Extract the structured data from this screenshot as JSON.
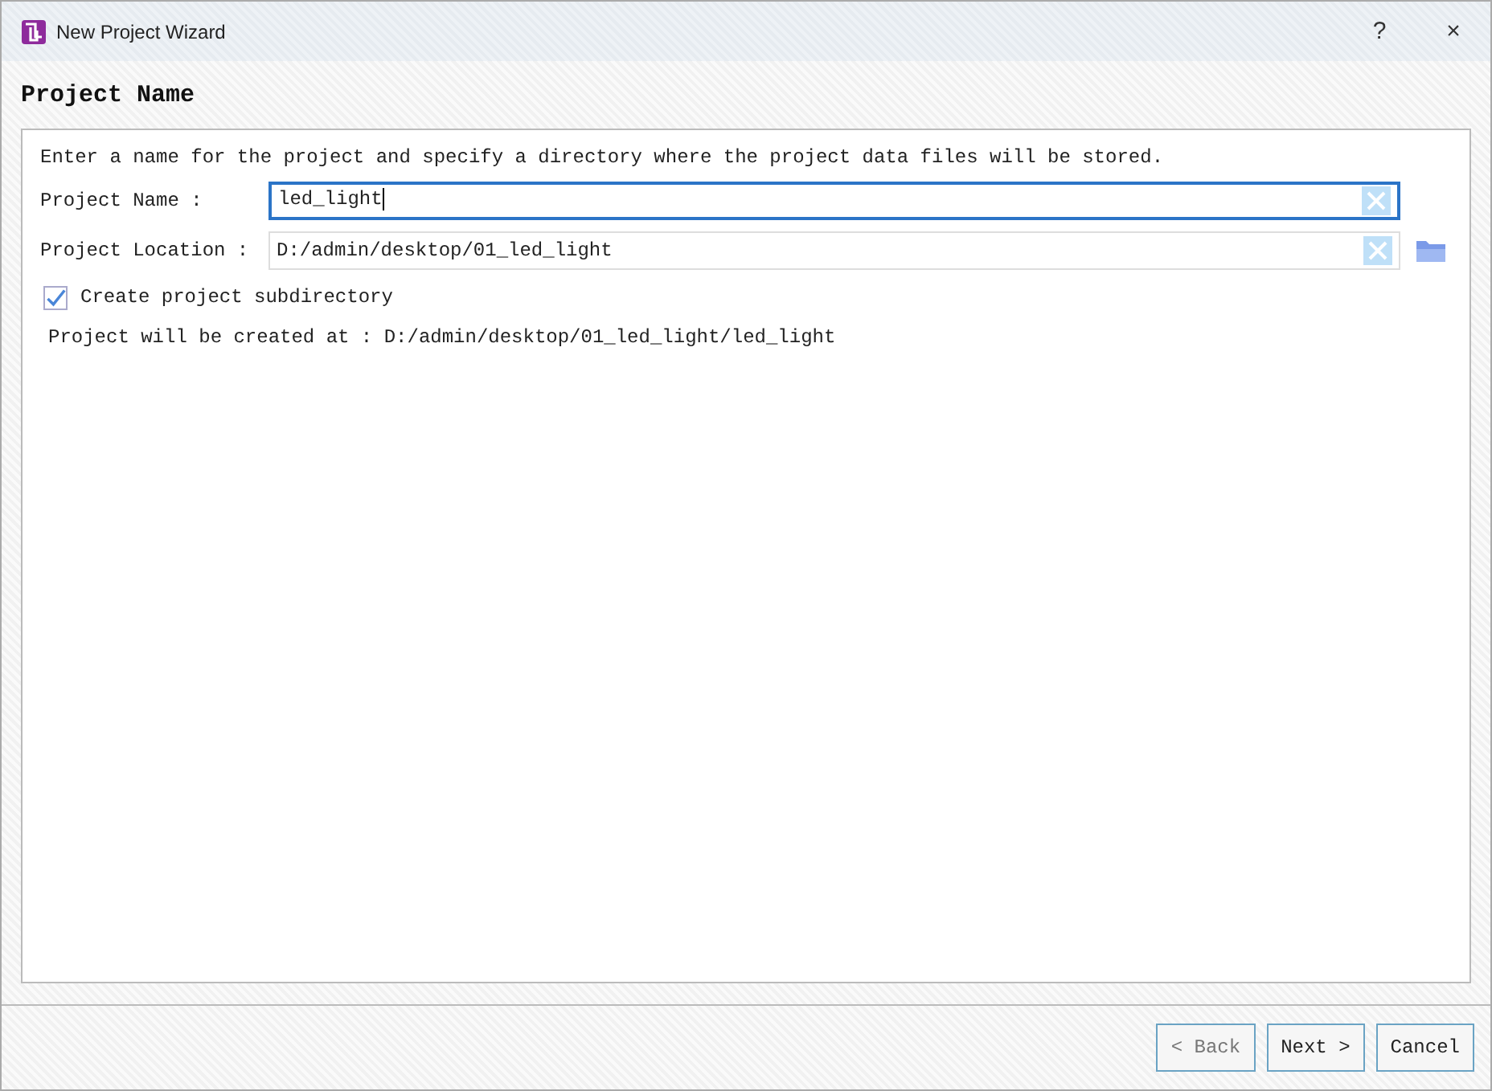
{
  "window": {
    "title": "New Project Wizard",
    "help": "?",
    "close": "×"
  },
  "page_title": "Project Name",
  "intro": "Enter a name for the project and specify a directory where the project data files will be stored.",
  "fields": [
    {
      "label": "Project Name :",
      "value": "led_light",
      "focused": true,
      "browse": false
    },
    {
      "label": "Project Location :",
      "value": "D:/admin/desktop/01_led_light",
      "focused": false,
      "browse": true
    }
  ],
  "checkbox": {
    "label": "Create project subdirectory",
    "checked": true
  },
  "result": "Project will be created at : D:/admin/desktop/01_led_light/led_light",
  "buttons": [
    {
      "label": "< Back",
      "disabled": true
    },
    {
      "label": "Next >",
      "disabled": false
    },
    {
      "label": "Cancel",
      "disabled": false
    }
  ]
}
